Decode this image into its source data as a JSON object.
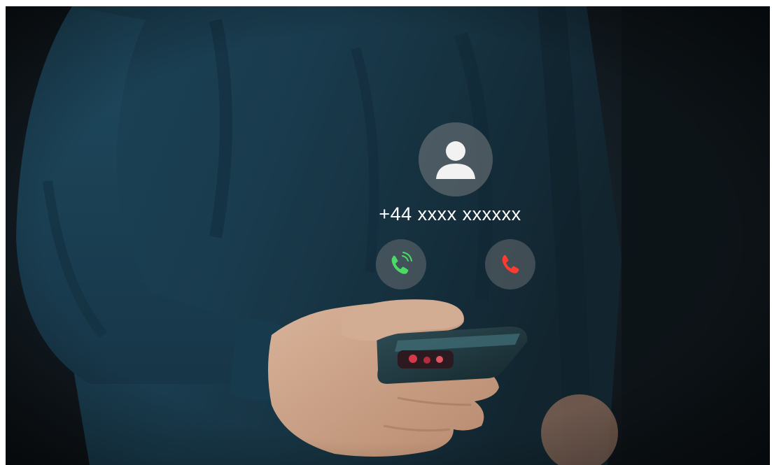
{
  "call": {
    "caller_number": "+44 xxxx xxxxxx",
    "avatar_icon": "user-avatar-icon",
    "accept_icon": "phone-ringing-icon",
    "decline_icon": "phone-hangup-icon",
    "accept_color": "#4cd964",
    "decline_color": "#ff3b30"
  }
}
